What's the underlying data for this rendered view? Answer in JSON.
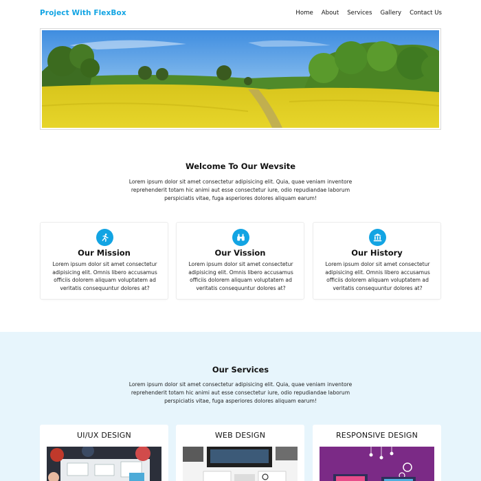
{
  "nav": {
    "brand": "Project With FlexBox",
    "links": [
      "Home",
      "About",
      "Services",
      "Gallery",
      "Contact Us"
    ]
  },
  "hero": {
    "image": "rapeseed-field-landscape"
  },
  "welcome": {
    "title": "Welcome To Our Wevsite",
    "text": "Lorem ipsum dolor sit amet consectetur adipisicing elit. Quia, quae veniam inventore reprehenderit totam hic animi aut esse consectetur iure, odio repudiandae laborum perspiciatis vitae, fuga asperiores dolores aliquam earum!"
  },
  "features": [
    {
      "icon": "running-person-icon",
      "title": "Our Mission",
      "text": "Lorem ipsum dolor sit amet consectetur adipisicing elit. Omnis libero accusamus officiis dolorem aliquam voluptatem ad veritatis consequuntur dolores at?"
    },
    {
      "icon": "binoculars-icon",
      "title": "Our Vission",
      "text": "Lorem ipsum dolor sit amet consectetur adipisicing elit. Omnis libero accusamus officiis dolorem aliquam voluptatem ad veritatis consequuntur dolores at?"
    },
    {
      "icon": "landmark-icon",
      "title": "Our History",
      "text": "Lorem ipsum dolor sit amet consectetur adipisicing elit. Omnis libero accusamus officiis dolorem aliquam voluptatem ad veritatis consequuntur dolores at?"
    }
  ],
  "services": {
    "title": "Our Services",
    "text": "Lorem ipsum dolor sit amet consectetur adipisicing elit. Quia, quae veniam inventore reprehenderit totam hic animi aut esse consectetur iure, odio repudiandae laborum perspiciatis vitae, fuga asperiores dolores aliquam earum!",
    "items": [
      {
        "title": "UI/UX DESIGN"
      },
      {
        "title": "WEB DESIGN"
      },
      {
        "title": "RESPONSIVE DESIGN"
      }
    ]
  },
  "colors": {
    "accent": "#12a4e3",
    "band": "#e7f5fc"
  }
}
